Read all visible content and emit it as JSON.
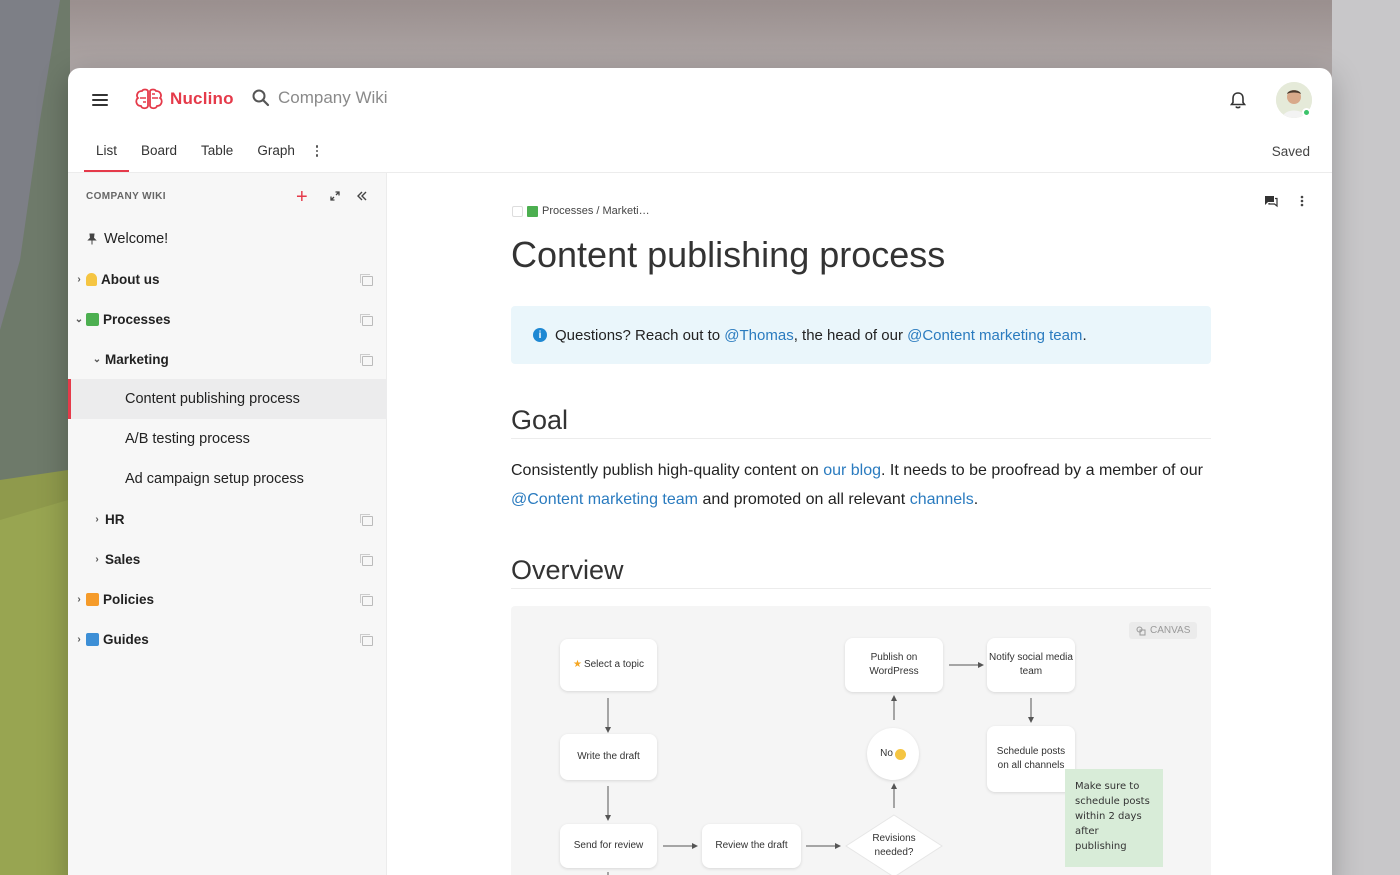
{
  "header": {
    "brand": "Nuclino",
    "search_placeholder": "Company Wiki"
  },
  "tabs": [
    {
      "label": "List"
    },
    {
      "label": "Board"
    },
    {
      "label": "Table"
    },
    {
      "label": "Graph"
    }
  ],
  "status": "Saved",
  "sidebar": {
    "title": "COMPANY WIKI",
    "items": [
      {
        "label": "Welcome!",
        "icon": "pin-icon"
      },
      {
        "label": "About us",
        "icon": "victory-hand-emoji"
      },
      {
        "label": "Processes",
        "icon": "green-book-emoji"
      },
      {
        "label": "Marketing"
      },
      {
        "label": "Content publishing process"
      },
      {
        "label": "A/B testing process"
      },
      {
        "label": "Ad campaign setup process"
      },
      {
        "label": "HR"
      },
      {
        "label": "Sales"
      },
      {
        "label": "Policies",
        "icon": "orange-book-emoji"
      },
      {
        "label": "Guides",
        "icon": "blue-book-emoji"
      }
    ]
  },
  "document": {
    "breadcrumb": "Processes / Marketi…",
    "title": "Content publishing process",
    "callout": {
      "before": "Questions? Reach out to ",
      "mention1": "@Thomas",
      "middle": ", the head of our ",
      "mention2": "@Content marketing team",
      "after": "."
    },
    "goal_heading": "Goal",
    "goal": {
      "t1": "Consistently publish high-quality content on ",
      "l1": "our blog",
      "t2": ". It needs to be proofread by a  member of our ",
      "l2": "@Content marketing team",
      "t3": " and promoted on all relevant ",
      "l3": "channels",
      "t4": "."
    },
    "overview_heading": "Overview",
    "canvas": {
      "badge": "CANVAS",
      "nodes": {
        "select_topic": "Select a topic",
        "write_draft": "Write the draft",
        "send_review": "Send for review",
        "review_draft": "Review the draft",
        "revisions": "Revisions needed?",
        "no": "No",
        "publish": "Publish on WordPress",
        "notify": "Notify social media team",
        "schedule": "Schedule posts on all channels"
      },
      "sticky": "Make sure to schedule posts within 2 days after publishing"
    }
  },
  "colors": {
    "accent": "#e53a4a",
    "link": "#2a7bbf",
    "callout_bg": "#eaf6fb",
    "sticky": "#d8ecd8"
  }
}
